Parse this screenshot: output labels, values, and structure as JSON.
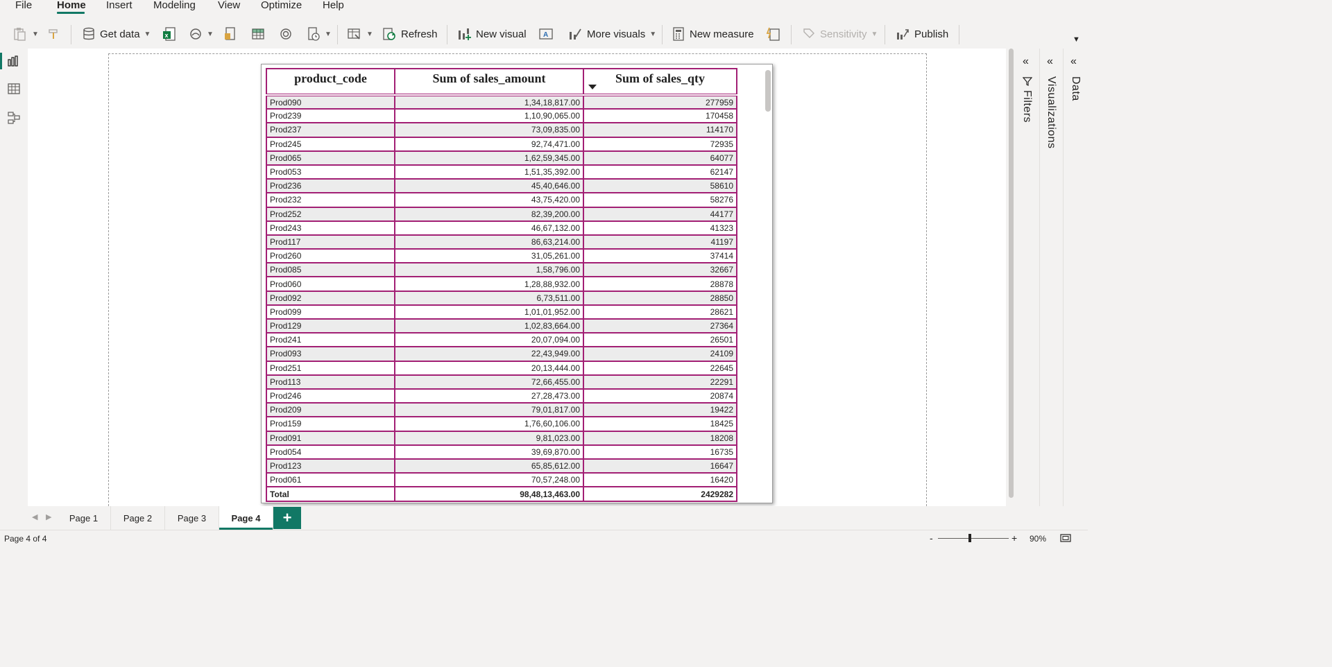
{
  "menu": {
    "items": [
      {
        "label": "File"
      },
      {
        "label": "Home"
      },
      {
        "label": "Insert"
      },
      {
        "label": "Modeling"
      },
      {
        "label": "View"
      },
      {
        "label": "Optimize"
      },
      {
        "label": "Help"
      }
    ],
    "active": "Home"
  },
  "ribbon": {
    "get_data": "Get data",
    "refresh": "Refresh",
    "new_visual": "New visual",
    "more_visuals": "More visuals",
    "new_measure": "New measure",
    "sensitivity": "Sensitivity",
    "publish": "Publish"
  },
  "table": {
    "headers": [
      "product_code",
      "Sum of sales_amount",
      "Sum of sales_qty"
    ],
    "sorted_column": "Sum of sales_qty",
    "rows": [
      [
        "Prod090",
        "1,34,18,817.00",
        "277959"
      ],
      [
        "Prod239",
        "1,10,90,065.00",
        "170458"
      ],
      [
        "Prod237",
        "73,09,835.00",
        "114170"
      ],
      [
        "Prod245",
        "92,74,471.00",
        "72935"
      ],
      [
        "Prod065",
        "1,62,59,345.00",
        "64077"
      ],
      [
        "Prod053",
        "1,51,35,392.00",
        "62147"
      ],
      [
        "Prod236",
        "45,40,646.00",
        "58610"
      ],
      [
        "Prod232",
        "43,75,420.00",
        "58276"
      ],
      [
        "Prod252",
        "82,39,200.00",
        "44177"
      ],
      [
        "Prod243",
        "46,67,132.00",
        "41323"
      ],
      [
        "Prod117",
        "86,63,214.00",
        "41197"
      ],
      [
        "Prod260",
        "31,05,261.00",
        "37414"
      ],
      [
        "Prod085",
        "1,58,796.00",
        "32667"
      ],
      [
        "Prod060",
        "1,28,88,932.00",
        "28878"
      ],
      [
        "Prod092",
        "6,73,511.00",
        "28850"
      ],
      [
        "Prod099",
        "1,01,01,952.00",
        "28621"
      ],
      [
        "Prod129",
        "1,02,83,664.00",
        "27364"
      ],
      [
        "Prod241",
        "20,07,094.00",
        "26501"
      ],
      [
        "Prod093",
        "22,43,949.00",
        "24109"
      ],
      [
        "Prod251",
        "20,13,444.00",
        "22645"
      ],
      [
        "Prod113",
        "72,66,455.00",
        "22291"
      ],
      [
        "Prod246",
        "27,28,473.00",
        "20874"
      ],
      [
        "Prod209",
        "79,01,817.00",
        "19422"
      ],
      [
        "Prod159",
        "1,76,60,106.00",
        "18425"
      ],
      [
        "Prod091",
        "9,81,023.00",
        "18208"
      ],
      [
        "Prod054",
        "39,69,870.00",
        "16735"
      ],
      [
        "Prod123",
        "65,85,612.00",
        "16647"
      ],
      [
        "Prod061",
        "70,57,248.00",
        "16420"
      ]
    ],
    "total": [
      "Total",
      "98,48,13,463.00",
      "2429282"
    ]
  },
  "panes": {
    "filters": "Filters",
    "visualizations": "Visualizations",
    "data": "Data"
  },
  "tabs": [
    {
      "label": "Page 1"
    },
    {
      "label": "Page 2"
    },
    {
      "label": "Page 3"
    },
    {
      "label": "Page 4"
    }
  ],
  "active_tab": "Page 4",
  "status": {
    "page_info": "Page 4 of 4",
    "zoom": "90%"
  },
  "colors": {
    "accent": "#117865",
    "table_border": "#a21f74",
    "row_alt": "#ececec"
  }
}
